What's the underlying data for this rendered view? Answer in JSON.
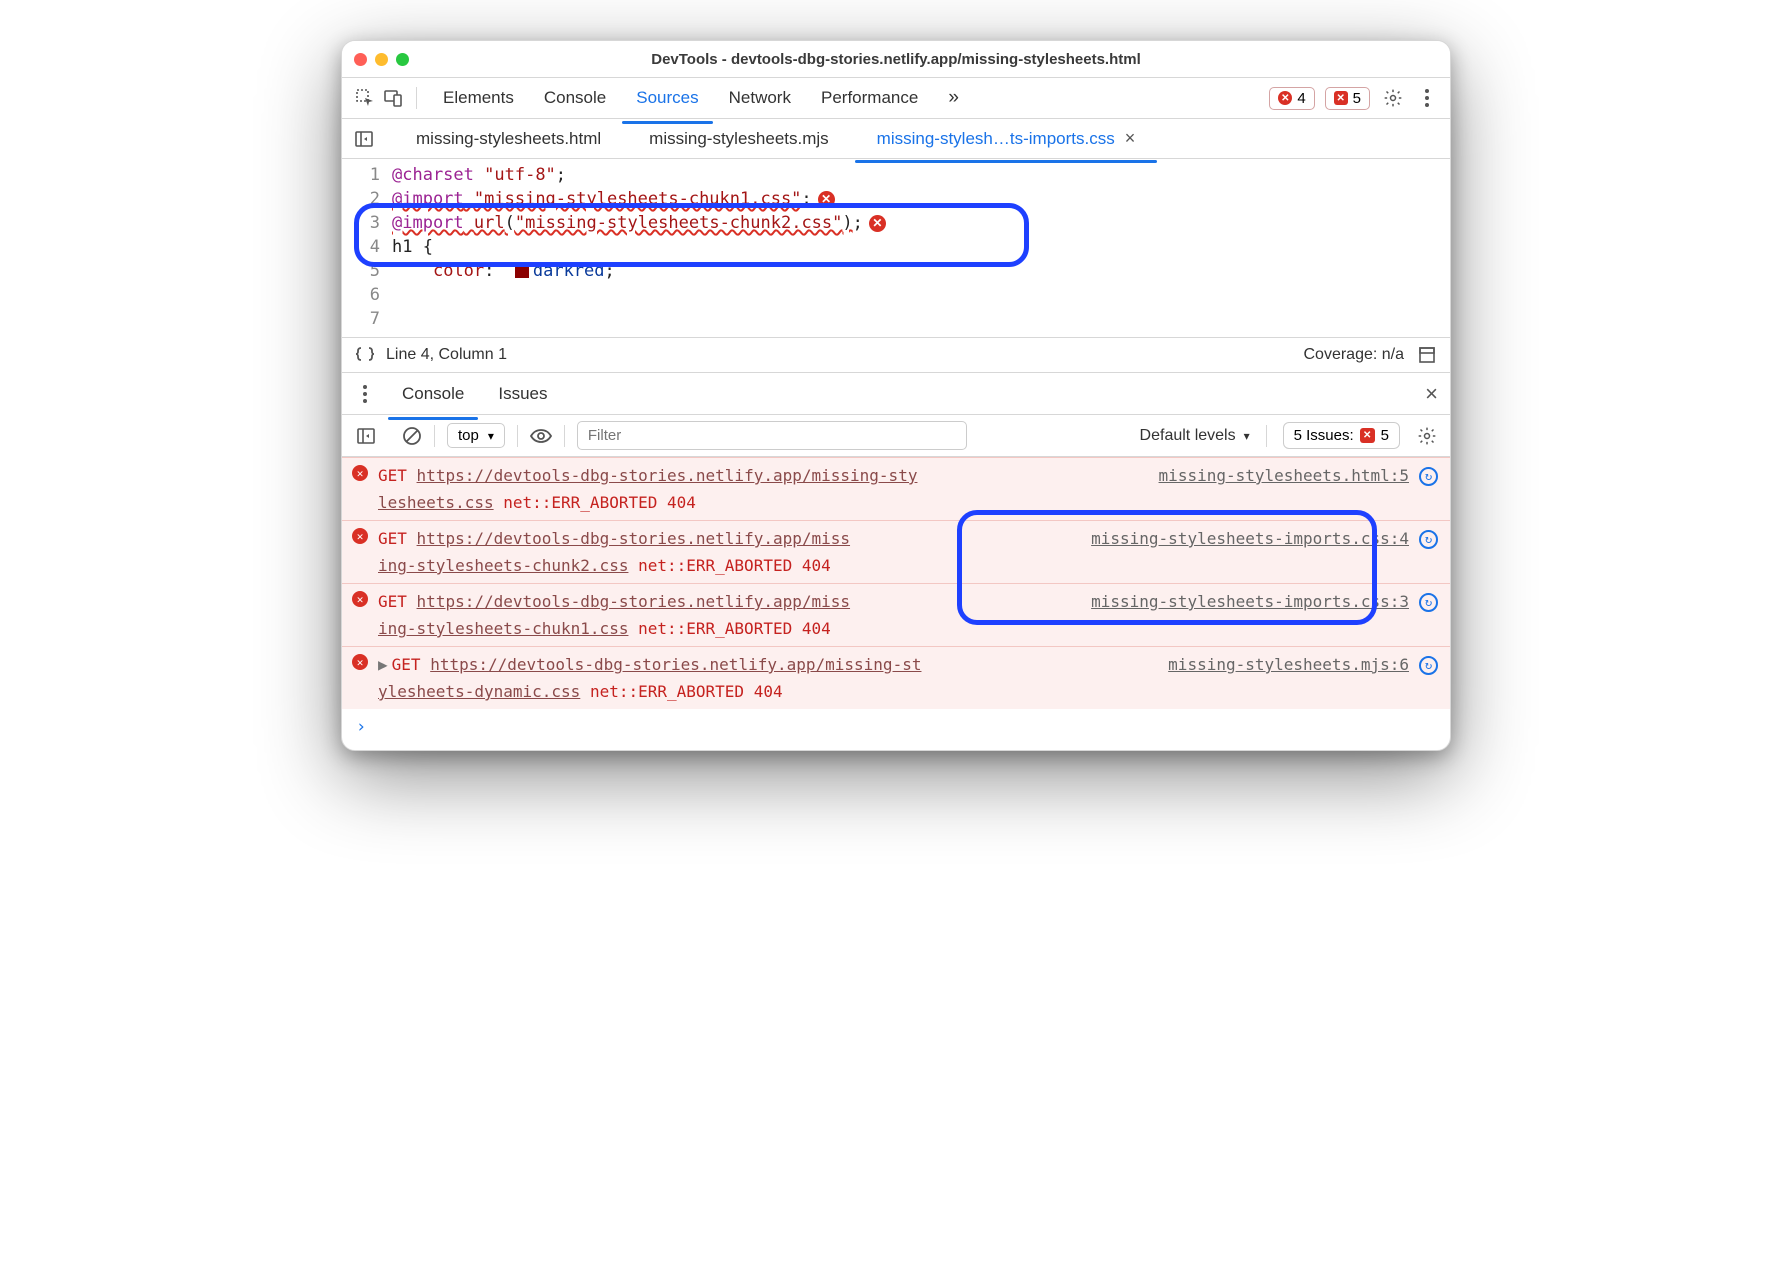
{
  "window": {
    "title": "DevTools - devtools-dbg-stories.netlify.app/missing-stylesheets.html"
  },
  "toolbar": {
    "panels": [
      "Elements",
      "Console",
      "Sources",
      "Network",
      "Performance"
    ],
    "active_panel": "Sources",
    "more_glyph": "»",
    "error_count": "4",
    "issue_count": "5"
  },
  "file_tabs": {
    "tabs": [
      "missing-stylesheets.html",
      "missing-stylesheets.mjs",
      "missing-stylesh…ts-imports.css"
    ],
    "active_index": 2
  },
  "source": {
    "lines": [
      {
        "n": "1",
        "parts": [
          {
            "t": "@charset",
            "c": "kw"
          },
          {
            "t": " ",
            "c": "plain"
          },
          {
            "t": "\"utf-8\"",
            "c": "str"
          },
          {
            "t": ";",
            "c": "plain"
          }
        ]
      },
      {
        "n": "2",
        "parts": []
      },
      {
        "n": "3",
        "err": true,
        "parts": [
          {
            "t": "@import",
            "c": "kw u"
          },
          {
            "t": " ",
            "c": "plain u"
          },
          {
            "t": "\"missing-stylesheets-chukn1.css\"",
            "c": "str u"
          },
          {
            "t": ";",
            "c": "plain"
          }
        ]
      },
      {
        "n": "4",
        "err": true,
        "parts": [
          {
            "t": "@import",
            "c": "kw u"
          },
          {
            "t": " ",
            "c": "plain u"
          },
          {
            "t": "url",
            "c": "prop u"
          },
          {
            "t": "(",
            "c": "plain u"
          },
          {
            "t": "\"missing-stylesheets-chunk2.css\"",
            "c": "str u"
          },
          {
            "t": ")",
            "c": "plain u"
          },
          {
            "t": ";",
            "c": "plain"
          }
        ]
      },
      {
        "n": "5",
        "parts": []
      },
      {
        "n": "6",
        "parts": [
          {
            "t": "h1 {",
            "c": "plain"
          }
        ]
      },
      {
        "n": "7",
        "parts": [
          {
            "t": "    ",
            "c": "plain"
          },
          {
            "t": "color",
            "c": "prop"
          },
          {
            "t": ":  ",
            "c": "plain"
          },
          {
            "t": "SWATCH",
            "c": "swatch"
          },
          {
            "t": "darkred",
            "c": "ident"
          },
          {
            "t": ";",
            "c": "plain"
          }
        ]
      }
    ]
  },
  "statusbar": {
    "cursor": "Line 4, Column 1",
    "coverage": "Coverage: n/a"
  },
  "drawer": {
    "tabs": [
      "Console",
      "Issues"
    ],
    "active": 0
  },
  "console_toolbar": {
    "context": "top",
    "filter_placeholder": "Filter",
    "levels": "Default levels",
    "issues_label": "5 Issues:",
    "issues_count": "5"
  },
  "console": {
    "messages": [
      {
        "get": "GET",
        "url_1": "https://devtools-dbg-stories.netlify.app/missing-sty",
        "url_2": "lesheets.css",
        "err": "net::ERR_ABORTED 404",
        "src": "missing-stylesheets.html:5",
        "expand": false
      },
      {
        "get": "GET",
        "url_1": "https://devtools-dbg-stories.netlify.app/miss",
        "url_2": "ing-stylesheets-chunk2.css",
        "err": "net::ERR_ABORTED 404",
        "src": "missing-stylesheets-imports.css:4",
        "expand": false
      },
      {
        "get": "GET",
        "url_1": "https://devtools-dbg-stories.netlify.app/miss",
        "url_2": "ing-stylesheets-chukn1.css",
        "err": "net::ERR_ABORTED 404",
        "src": "missing-stylesheets-imports.css:3",
        "expand": false
      },
      {
        "get": "GET",
        "url_1": "https://devtools-dbg-stories.netlify.app/missing-st",
        "url_2": "ylesheets-dynamic.css",
        "err": "net::ERR_ABORTED 404",
        "src": "missing-stylesheets.mjs:6",
        "expand": true
      }
    ],
    "prompt": "›"
  }
}
